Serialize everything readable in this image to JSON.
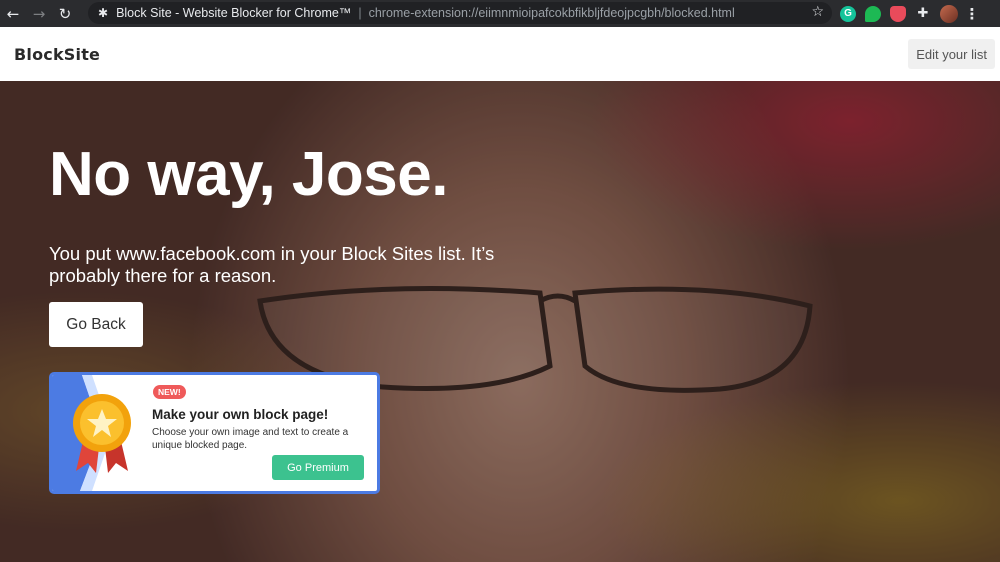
{
  "browser": {
    "tab_title": "Block Site - Website Blocker for Chrome™",
    "url": "chrome-extension://eiimnmioipafcokbfikbljfdeojpcgbh/blocked.html",
    "icons": {
      "back": "arrow-left-icon",
      "forward": "arrow-right-icon",
      "reload": "reload-icon",
      "star": "star-icon"
    },
    "extensions": [
      "grammarly-icon",
      "green-extension-icon",
      "shield-extension-icon",
      "puzzle-icon",
      "profile-avatar",
      "menu-icon"
    ]
  },
  "app": {
    "logo": "BlockSite",
    "edit_list_label": "Edit your list"
  },
  "hero": {
    "headline": "No way, Jose.",
    "message": "You put www.facebook.com in your Block Sites list. It’s probably there for a reason.",
    "go_back_label": "Go Back"
  },
  "promo": {
    "badge": "NEW!",
    "title": "Make your own block page!",
    "description": "Choose your own image and text to create a unique blocked page.",
    "button_label": "Go Premium",
    "accent_color": "#4c7be3",
    "button_color": "#3cc28f"
  }
}
